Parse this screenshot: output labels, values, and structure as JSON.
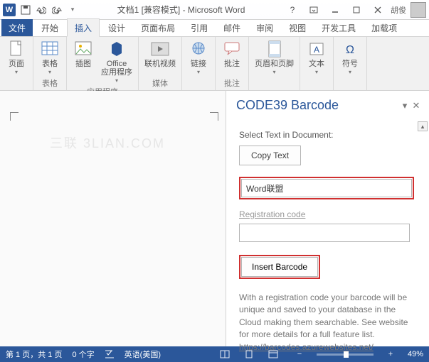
{
  "titlebar": {
    "doc_title": "文档1 [兼容模式] - Microsoft Word",
    "user_name": "胡俊"
  },
  "tabs": {
    "file": "文件",
    "home": "开始",
    "insert": "插入",
    "design": "设计",
    "layout": "页面布局",
    "references": "引用",
    "mailings": "邮件",
    "review": "审阅",
    "view": "视图",
    "developer": "开发工具",
    "addins": "加载项"
  },
  "ribbon": {
    "pages": {
      "cover": "页面",
      "group": ""
    },
    "tables": {
      "btn": "表格",
      "group": "表格"
    },
    "illus": {
      "pic": "插图",
      "office": "Office\n应用程序",
      "group": "应用程序"
    },
    "media": {
      "video": "联机视频",
      "group": "媒体"
    },
    "links": {
      "btn": "链接",
      "group": ""
    },
    "comments": {
      "btn": "批注",
      "group": "批注"
    },
    "headerfooter": {
      "btn": "页眉和页脚",
      "group": ""
    },
    "text": {
      "btn": "文本",
      "group": ""
    },
    "symbols": {
      "btn": "符号",
      "group": ""
    }
  },
  "watermark": "三联 3LIAN.COM",
  "pane": {
    "title": "CODE39 Barcode",
    "select_label": "Select Text in Document:",
    "copy_btn": "Copy Text",
    "text_value": "Word联盟",
    "reg_label": "Registration code",
    "reg_value": "",
    "insert_btn": "Insert Barcode",
    "info": "With a registration code your barcode will be unique and saved to your database in the Cloud making them searchable.  See website for more details for a full feature list. ",
    "info_link": "https://barcodes.azurewebsites.net/"
  },
  "status": {
    "page": "第 1 页，共 1 页",
    "words": "0 个字",
    "lang": "英语(美国)",
    "zoom": "49%"
  }
}
